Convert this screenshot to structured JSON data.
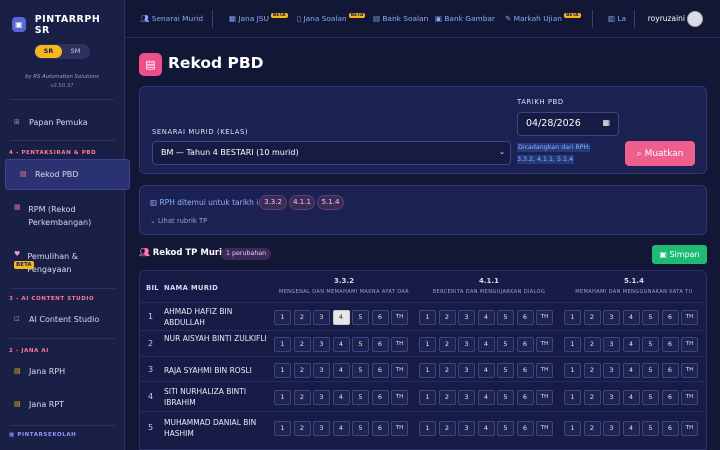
{
  "app": {
    "name": "PINTARRPH SR",
    "mode_sr": "SR",
    "mode_sm": "SM",
    "byline": "by RS Automation Solutions",
    "version": "v2.50.37"
  },
  "sidebar": {
    "home": "Papan Pemuka",
    "sec1": "4 - PENTAKSIRAN & PBD",
    "rekod": "Rekod PBD",
    "rpm": "RPM (Rekod Perkembangan)",
    "pemulihan": "Pemulihan & Pengayaan",
    "beta": "BETA",
    "sec2": "3 - AI CONTENT STUDIO",
    "aistudio": "AI Content Studio",
    "sec3": "2 - JANA AI",
    "janarph": "Jana RPH",
    "janarpt": "Jana RPT",
    "footer": "PINTARSEKOLAH"
  },
  "nav": {
    "senarai": "Senarai Murid",
    "jana_jsu": "Jana JSU",
    "jana_soalan": "Jana Soalan",
    "bank_soalan": "Bank Soalan",
    "bank_gambar": "Bank Gambar",
    "markah": "Markah Ujian",
    "beta": "BETA",
    "la": "La",
    "user": "royruzaini"
  },
  "page": {
    "title": "Rekod PBD"
  },
  "form": {
    "kelas_label": "SENARAI MURID (KELAS)",
    "kelas_value": "BM — Tahun 4 BESTARI (10 murid)",
    "tarikh_label": "TARIKH PBD",
    "tarikh_value": "04/28/2026",
    "hint": "Dicadangkan dari RPH: 3.3.2, 4.1.1, 5.1.4",
    "muatkan": "Muatkan"
  },
  "rph": {
    "text": "RPH ditemui untuk tarikh ini",
    "chips": [
      "3.3.2",
      "4.1.1",
      "5.1.4"
    ],
    "lihat": "Lihat rubrik TP"
  },
  "rekod": {
    "title": "Rekod TP Murid",
    "badge": "1 perubahan",
    "simpan": "Simpan"
  },
  "table": {
    "col_bil": "BIL",
    "col_nama": "NAMA MURID",
    "standards": [
      {
        "code": "3.3.2",
        "desc": "MENGENAL DAN MEMAHAMI MAKNA AYAT DAR"
      },
      {
        "code": "4.1.1",
        "desc": "BERCERITA DAN MENGUJARKAN DIALOG"
      },
      {
        "code": "5.1.4",
        "desc": "MEMAHAMI DAN MENGGUNAKAN KATA TU"
      }
    ],
    "scores": [
      "1",
      "2",
      "3",
      "4",
      "5",
      "6",
      "TH"
    ],
    "rows": [
      {
        "bil": "1",
        "nama": "AHMAD HAFIZ BIN ABDULLAH",
        "sel": [
          4,
          null,
          null
        ]
      },
      {
        "bil": "2",
        "nama": "NUR AISYAH BINTI ZULKIFLI",
        "sel": [
          null,
          null,
          null
        ]
      },
      {
        "bil": "3",
        "nama": "RAJA SYAHMI BIN ROSLI",
        "sel": [
          null,
          null,
          null
        ]
      },
      {
        "bil": "4",
        "nama": "SITI NURHALIZA BINTI IBRAHIM",
        "sel": [
          null,
          null,
          null
        ]
      },
      {
        "bil": "5",
        "nama": "MUHAMMAD DANIAL BIN HASHIM",
        "sel": [
          null,
          null,
          null
        ]
      }
    ]
  }
}
